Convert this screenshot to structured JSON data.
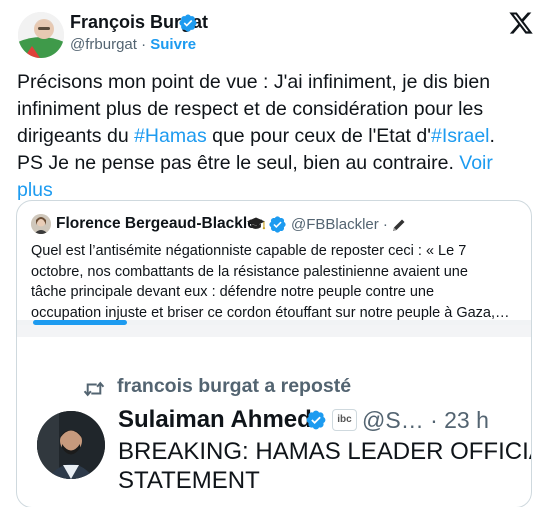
{
  "author": {
    "name": "François Burgat",
    "handle": "@frburgat",
    "separator": "·",
    "follow_label": "Suivre"
  },
  "tweet": {
    "lines": [
      "Précisons mon point de vue :  J'ai infiniment, je dis bien",
      "infiniment plus de respect et de considération  pour les"
    ],
    "line3_pre": "dirigeants du ",
    "hashtag1": "#Hamas",
    "line3_mid": " que pour ceux de l'Etat d'",
    "hashtag2": "#Israel",
    "line3_post": ".",
    "line4": "PS Je ne pense pas être le seul, bien au contraire. ",
    "more_a": "Voir",
    "more_b": "plus"
  },
  "quote": {
    "name": "Florence Bergeaud-Blackler",
    "handle": "@FBBlackler",
    "separator": "·",
    "lines": [
      "Quel est l’antisémite négationniste capable de  reposter ceci : « Le 7",
      "octobre, nos combattants de la résistance palestinienne avaient une",
      "tâche principale devant eux : défendre notre peuple contre une",
      "occupation injuste et briser ce cordon étouffant sur notre peuple à Gaza,…"
    ],
    "scroll_progress": 0.18
  },
  "repost": {
    "label": "francois burgat a reposté",
    "name": "Sulaiman Ahmed",
    "badge": "ibc",
    "handle_time": "@S… · 23 h",
    "text_lines": [
      "BREAKING: HAMAS LEADER OFFICIAL",
      "STATEMENT"
    ]
  },
  "colors": {
    "accent": "#1d9bf0",
    "text": "#0f1419",
    "muted": "#536471",
    "border": "#cfd9de"
  },
  "icons": [
    "verified-badge-icon",
    "x-logo-icon",
    "graduation-cap-icon",
    "pen-icon",
    "repost-icon"
  ]
}
